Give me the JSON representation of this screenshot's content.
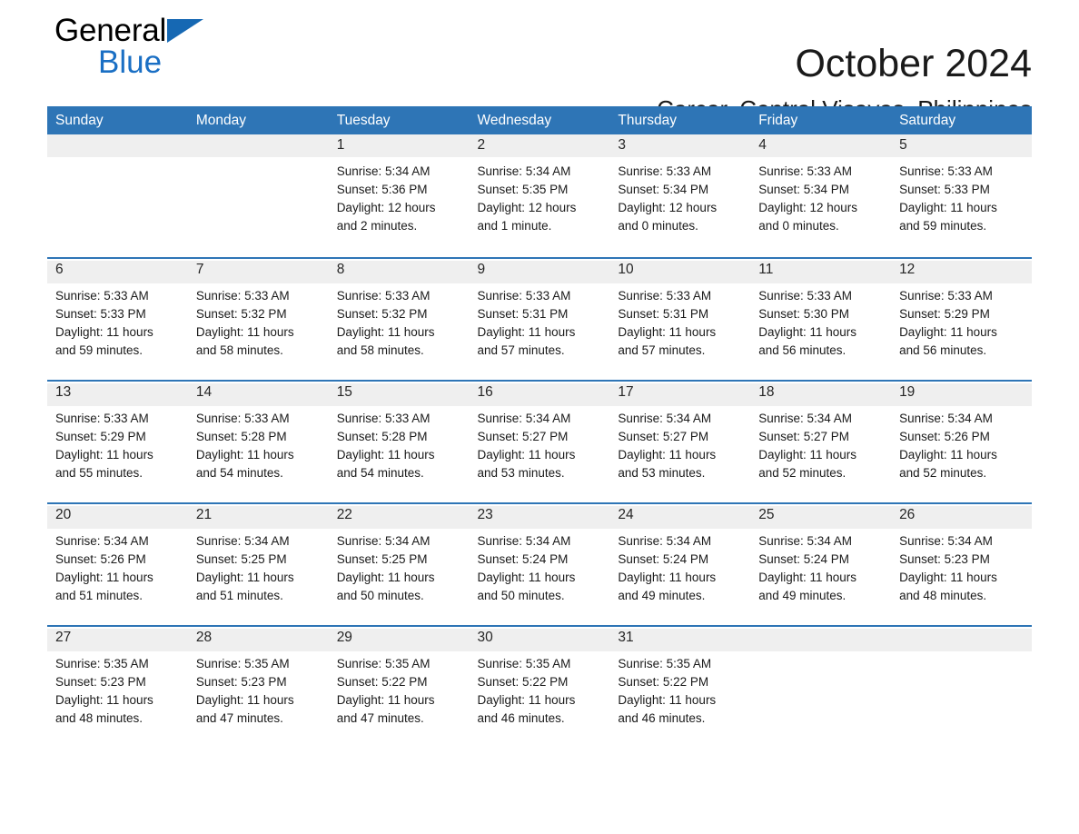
{
  "brand": {
    "logo_line1": "General",
    "logo_line2": "Blue",
    "accent_color": "#1a6fc4",
    "mark_color": "#1668b3",
    "header_bar_color": "#2e75b6",
    "daynum_band_color": "#efefef"
  },
  "header": {
    "title": "October 2024",
    "subtitle": "Carcar, Central Visayas, Philippines"
  },
  "weekdays": [
    "Sunday",
    "Monday",
    "Tuesday",
    "Wednesday",
    "Thursday",
    "Friday",
    "Saturday"
  ],
  "weeks": [
    {
      "days": [
        {
          "num": "",
          "detail": ""
        },
        {
          "num": "",
          "detail": ""
        },
        {
          "num": "1",
          "detail": "Sunrise: 5:34 AM\nSunset: 5:36 PM\nDaylight: 12 hours\nand 2 minutes."
        },
        {
          "num": "2",
          "detail": "Sunrise: 5:34 AM\nSunset: 5:35 PM\nDaylight: 12 hours\nand 1 minute."
        },
        {
          "num": "3",
          "detail": "Sunrise: 5:33 AM\nSunset: 5:34 PM\nDaylight: 12 hours\nand 0 minutes."
        },
        {
          "num": "4",
          "detail": "Sunrise: 5:33 AM\nSunset: 5:34 PM\nDaylight: 12 hours\nand 0 minutes."
        },
        {
          "num": "5",
          "detail": "Sunrise: 5:33 AM\nSunset: 5:33 PM\nDaylight: 11 hours\nand 59 minutes."
        }
      ]
    },
    {
      "days": [
        {
          "num": "6",
          "detail": "Sunrise: 5:33 AM\nSunset: 5:33 PM\nDaylight: 11 hours\nand 59 minutes."
        },
        {
          "num": "7",
          "detail": "Sunrise: 5:33 AM\nSunset: 5:32 PM\nDaylight: 11 hours\nand 58 minutes."
        },
        {
          "num": "8",
          "detail": "Sunrise: 5:33 AM\nSunset: 5:32 PM\nDaylight: 11 hours\nand 58 minutes."
        },
        {
          "num": "9",
          "detail": "Sunrise: 5:33 AM\nSunset: 5:31 PM\nDaylight: 11 hours\nand 57 minutes."
        },
        {
          "num": "10",
          "detail": "Sunrise: 5:33 AM\nSunset: 5:31 PM\nDaylight: 11 hours\nand 57 minutes."
        },
        {
          "num": "11",
          "detail": "Sunrise: 5:33 AM\nSunset: 5:30 PM\nDaylight: 11 hours\nand 56 minutes."
        },
        {
          "num": "12",
          "detail": "Sunrise: 5:33 AM\nSunset: 5:29 PM\nDaylight: 11 hours\nand 56 minutes."
        }
      ]
    },
    {
      "days": [
        {
          "num": "13",
          "detail": "Sunrise: 5:33 AM\nSunset: 5:29 PM\nDaylight: 11 hours\nand 55 minutes."
        },
        {
          "num": "14",
          "detail": "Sunrise: 5:33 AM\nSunset: 5:28 PM\nDaylight: 11 hours\nand 54 minutes."
        },
        {
          "num": "15",
          "detail": "Sunrise: 5:33 AM\nSunset: 5:28 PM\nDaylight: 11 hours\nand 54 minutes."
        },
        {
          "num": "16",
          "detail": "Sunrise: 5:34 AM\nSunset: 5:27 PM\nDaylight: 11 hours\nand 53 minutes."
        },
        {
          "num": "17",
          "detail": "Sunrise: 5:34 AM\nSunset: 5:27 PM\nDaylight: 11 hours\nand 53 minutes."
        },
        {
          "num": "18",
          "detail": "Sunrise: 5:34 AM\nSunset: 5:27 PM\nDaylight: 11 hours\nand 52 minutes."
        },
        {
          "num": "19",
          "detail": "Sunrise: 5:34 AM\nSunset: 5:26 PM\nDaylight: 11 hours\nand 52 minutes."
        }
      ]
    },
    {
      "days": [
        {
          "num": "20",
          "detail": "Sunrise: 5:34 AM\nSunset: 5:26 PM\nDaylight: 11 hours\nand 51 minutes."
        },
        {
          "num": "21",
          "detail": "Sunrise: 5:34 AM\nSunset: 5:25 PM\nDaylight: 11 hours\nand 51 minutes."
        },
        {
          "num": "22",
          "detail": "Sunrise: 5:34 AM\nSunset: 5:25 PM\nDaylight: 11 hours\nand 50 minutes."
        },
        {
          "num": "23",
          "detail": "Sunrise: 5:34 AM\nSunset: 5:24 PM\nDaylight: 11 hours\nand 50 minutes."
        },
        {
          "num": "24",
          "detail": "Sunrise: 5:34 AM\nSunset: 5:24 PM\nDaylight: 11 hours\nand 49 minutes."
        },
        {
          "num": "25",
          "detail": "Sunrise: 5:34 AM\nSunset: 5:24 PM\nDaylight: 11 hours\nand 49 minutes."
        },
        {
          "num": "26",
          "detail": "Sunrise: 5:34 AM\nSunset: 5:23 PM\nDaylight: 11 hours\nand 48 minutes."
        }
      ]
    },
    {
      "days": [
        {
          "num": "27",
          "detail": "Sunrise: 5:35 AM\nSunset: 5:23 PM\nDaylight: 11 hours\nand 48 minutes."
        },
        {
          "num": "28",
          "detail": "Sunrise: 5:35 AM\nSunset: 5:23 PM\nDaylight: 11 hours\nand 47 minutes."
        },
        {
          "num": "29",
          "detail": "Sunrise: 5:35 AM\nSunset: 5:22 PM\nDaylight: 11 hours\nand 47 minutes."
        },
        {
          "num": "30",
          "detail": "Sunrise: 5:35 AM\nSunset: 5:22 PM\nDaylight: 11 hours\nand 46 minutes."
        },
        {
          "num": "31",
          "detail": "Sunrise: 5:35 AM\nSunset: 5:22 PM\nDaylight: 11 hours\nand 46 minutes."
        },
        {
          "num": "",
          "detail": ""
        },
        {
          "num": "",
          "detail": ""
        }
      ]
    }
  ]
}
